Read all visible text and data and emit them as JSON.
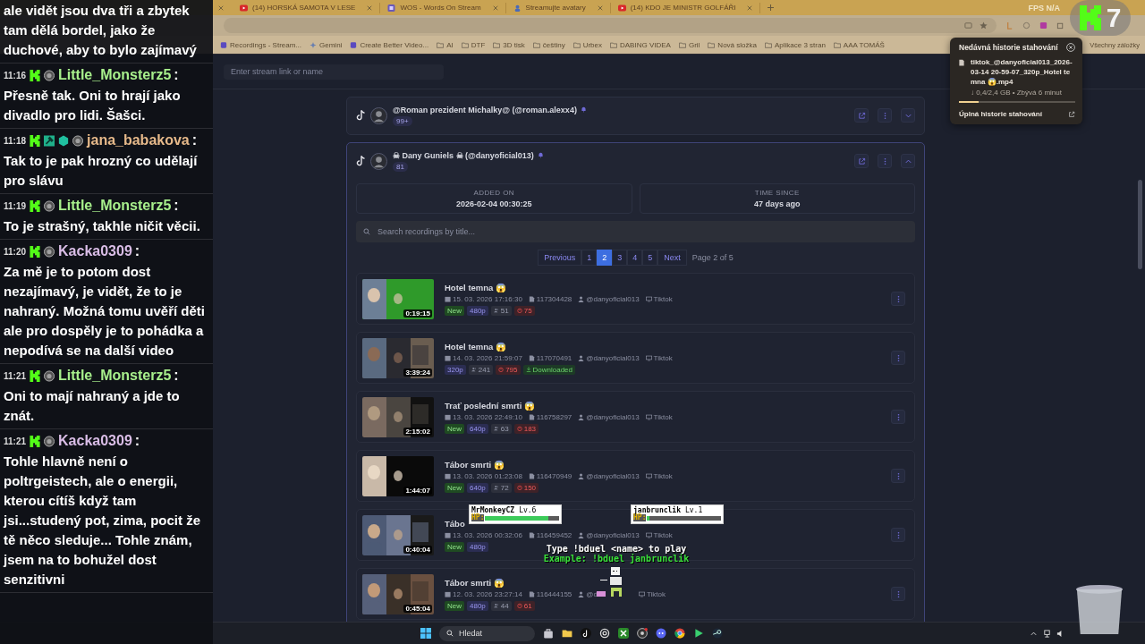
{
  "browser": {
    "tabs": [
      {
        "title": "(14) HORSKÁ SAMOTA V LESE",
        "kind": "video"
      },
      {
        "title": "WOS - Words On Stream",
        "kind": "app"
      },
      {
        "title": "Streamujte avatary",
        "kind": "avatar"
      },
      {
        "title": "(14) KDO JE MINISTR GOLFÁŘI",
        "kind": "video"
      }
    ],
    "perf": "FPS N/A",
    "bookmarks": [
      {
        "label": "Recordings - Stream...",
        "kind": "page"
      },
      {
        "label": "Gemini",
        "kind": "star"
      },
      {
        "label": "Create Better Video...",
        "kind": "page"
      },
      {
        "label": "AI",
        "kind": "folder"
      },
      {
        "label": "DTF",
        "kind": "folder"
      },
      {
        "label": "3D tisk",
        "kind": "folder"
      },
      {
        "label": "češtiny",
        "kind": "folder"
      },
      {
        "label": "Urbex",
        "kind": "folder"
      },
      {
        "label": "DABING VIDEA",
        "kind": "folder"
      },
      {
        "label": "Gril",
        "kind": "folder"
      },
      {
        "label": "Nová složka",
        "kind": "folder"
      },
      {
        "label": "Aplikace 3 stran",
        "kind": "folder"
      },
      {
        "label": "AAA TOMÁŠ",
        "kind": "folder"
      }
    ],
    "all_bookmarks": "Všechny záložky"
  },
  "app": {
    "stream_input": {
      "placeholder": "Enter stream link or name"
    },
    "streamers": [
      {
        "name": "@Roman prezident Michalky@ (@roman.alexx4)",
        "count": "99+",
        "expanded": false
      },
      {
        "name": "☠ Dany Guniels ☠ (@danyoficial013)",
        "count": "81",
        "expanded": true,
        "stats": [
          {
            "label": "ADDED ON",
            "value": "2026-02-04 00:30:25"
          },
          {
            "label": "TIME SINCE",
            "value": "47 days ago"
          }
        ],
        "search": {
          "placeholder": "Search recordings by title..."
        },
        "pagination": {
          "previous": "Previous",
          "next": "Next",
          "summary": "Page 2 of 5",
          "pages": [
            {
              "label": "1",
              "selected": false
            },
            {
              "label": "2",
              "selected": true
            },
            {
              "label": "3",
              "selected": false
            },
            {
              "label": "4",
              "selected": false
            },
            {
              "label": "5",
              "selected": false
            }
          ]
        },
        "recordings": [
          {
            "title": "Hotel temna 😱",
            "date": "15. 03. 2026 17:16:30",
            "id": "117304428",
            "owner": "@danyoficial013",
            "platform": "Tiktok",
            "duration": "0:19:15",
            "tags": [
              {
                "kind": "new",
                "label": "New"
              },
              {
                "kind": "quality",
                "label": "480p"
              },
              {
                "kind": "viewers",
                "label": "51"
              },
              {
                "kind": "likes",
                "label": "75"
              }
            ]
          },
          {
            "title": "Hotel temna 😱",
            "date": "14. 03. 2026 21:59:07",
            "id": "117070491",
            "owner": "@danyoficial013",
            "platform": "Tiktok",
            "duration": "3:39:24",
            "tags": [
              {
                "kind": "quality",
                "label": "320p"
              },
              {
                "kind": "viewers",
                "label": "241"
              },
              {
                "kind": "likes",
                "label": "795"
              },
              {
                "kind": "downloaded",
                "label": "Downloaded"
              }
            ]
          },
          {
            "title": "Trať poslední smrti 😱",
            "date": "13. 03. 2026 22:49:10",
            "id": "116758297",
            "owner": "@danyoficial013",
            "platform": "Tiktok",
            "duration": "2:15:02",
            "tags": [
              {
                "kind": "new",
                "label": "New"
              },
              {
                "kind": "quality",
                "label": "640p"
              },
              {
                "kind": "viewers",
                "label": "63"
              },
              {
                "kind": "likes",
                "label": "183"
              }
            ]
          },
          {
            "title": "Tábor smrti 😱",
            "date": "13. 03. 2026 01:23:08",
            "id": "116470949",
            "owner": "@danyoficial013",
            "platform": "Tiktok",
            "duration": "1:44:07",
            "tags": [
              {
                "kind": "new",
                "label": "New"
              },
              {
                "kind": "quality",
                "label": "640p"
              },
              {
                "kind": "viewers",
                "label": "72"
              },
              {
                "kind": "likes",
                "label": "150"
              }
            ]
          },
          {
            "title": "Tábo",
            "date": "13. 03. 2026 00:32:06",
            "id": "116459452",
            "owner": "@danyoficial013",
            "platform": "Tiktok",
            "duration": "0:40:04",
            "tags": [
              {
                "kind": "new",
                "label": "New"
              },
              {
                "kind": "quality",
                "label": "480p"
              }
            ]
          },
          {
            "title": "Tábor smrti 😱",
            "date": "12. 03. 2026 23:27:14",
            "id": "116444155",
            "owner": "@d",
            "platform": "Tiktok",
            "duration": "0:45:04",
            "tags": [
              {
                "kind": "new",
                "label": "New"
              },
              {
                "kind": "quality",
                "label": "480p"
              },
              {
                "kind": "viewers",
                "label": "44"
              },
              {
                "kind": "likes",
                "label": "61"
              }
            ]
          }
        ]
      }
    ]
  },
  "downloads": {
    "title": "Nedávná historie stahování",
    "file": "tiktok_@danyoficial013_2026-03-14 20-59-07_320p_Hotel temna 😱.mp4",
    "progress_text": "↓ 0,4/2,4 GB • Zbývá 6 minut",
    "level": 0.17,
    "footer": "Úplná historie stahování"
  },
  "stream_overlay": {
    "counter": "7",
    "duel": {
      "players": [
        {
          "name": "MrMonkeyCZ",
          "lv": "Lv.6",
          "hp_label": "HP:",
          "level": 0.85
        },
        {
          "name": "janbrunclik",
          "lv": "Lv.1",
          "hp_label": "HP:",
          "level": 0.03
        }
      ],
      "instruction": "Type !bduel <name> to play",
      "example": "Example: !bduel janbrunclik"
    }
  },
  "chat": [
    {
      "text": "ale vidět jsou dva tři a zbytek tam dělá bordel, jako že duchové, aby to bylo zajímavý"
    },
    {
      "time": "11:16",
      "badges": [
        {
          "kind": "k"
        },
        {
          "kind": "medal"
        }
      ],
      "user": "Little_Monsterz5",
      "color": "#a8f08c",
      "separator": ":",
      "text": "Přesně tak. Oni to hrají jako divadlo pro lidi. Šašci."
    },
    {
      "time": "11:18",
      "badges": [
        {
          "kind": "k"
        },
        {
          "kind": "hammer"
        },
        {
          "kind": "gem"
        },
        {
          "kind": "medal"
        }
      ],
      "user": "jana_babakova",
      "color": "#e6b98a",
      "separator": ":",
      "text": "Tak to je pak hrozný co udělají pro slávu"
    },
    {
      "time": "11:19",
      "badges": [
        {
          "kind": "k"
        },
        {
          "kind": "medal"
        }
      ],
      "user": "Little_Monsterz5",
      "color": "#a8f08c",
      "separator": ":",
      "text": "To je strašný, takhle ničit věcii."
    },
    {
      "time": "11:20",
      "badges": [
        {
          "kind": "k"
        },
        {
          "kind": "medal"
        }
      ],
      "user": "Kacka0309",
      "color": "#d9bde6",
      "separator": ":",
      "text": "Za mě je to potom dost nezajímavý, je vidět, že to je nahraný. Možná tomu uvěří děti ale pro dospěly je to pohádka a nepodívá se na další video"
    },
    {
      "time": "11:21",
      "badges": [
        {
          "kind": "k"
        },
        {
          "kind": "medal"
        }
      ],
      "user": "Little_Monsterz5",
      "color": "#a8f08c",
      "separator": ":",
      "text": "Oni to mají nahraný a jde to znát."
    },
    {
      "time": "11:21",
      "badges": [
        {
          "kind": "k"
        },
        {
          "kind": "medal"
        }
      ],
      "user": "Kacka0309",
      "color": "#d9bde6",
      "separator": ":",
      "text": "Tohle hlavně není o poltrgeistech, ale o energii, kterou cítíš když tam jsi...studený pot, zima, pocit že tě něco sleduje... Tohle znám, jsem na to bohužel dost senzitivni"
    }
  ],
  "taskbar": {
    "search": {
      "placeholder": "Hledat"
    }
  }
}
